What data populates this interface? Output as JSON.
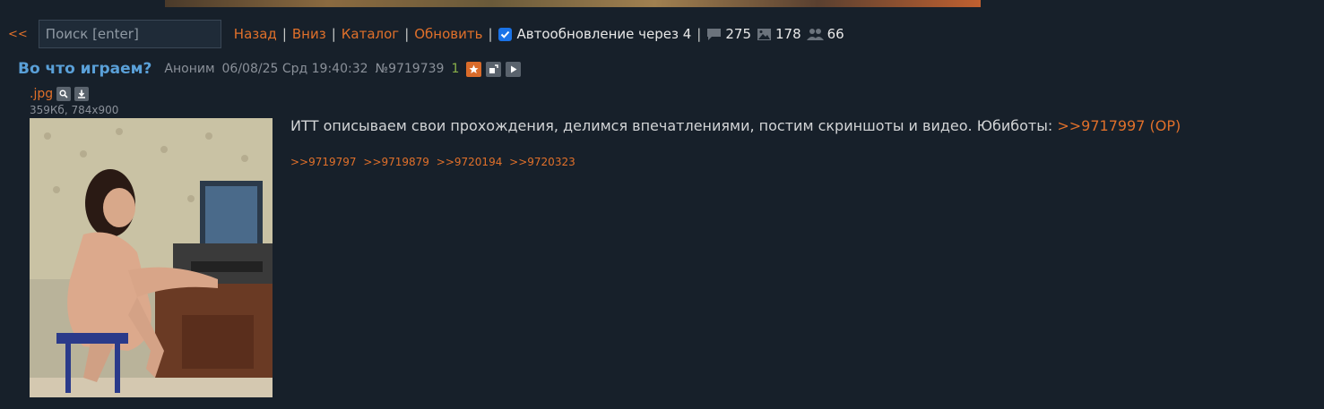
{
  "toolbar": {
    "back_label": "<<",
    "search_placeholder": "Поиск [enter]",
    "links": [
      "Назад",
      "Вниз",
      "Каталог",
      "Обновить"
    ],
    "autoupdate_label": "Автообновление через 4",
    "autoupdate_checked": true,
    "posts_count": "275",
    "images_count": "178",
    "posters_count": "66"
  },
  "post": {
    "subject": "Во что играем?",
    "author": "Аноним",
    "datetime": "06/08/25 Срд 19:40:32",
    "number": "№9719739",
    "reply_count": "1",
    "file": {
      "name": ".jpg",
      "meta": "359Кб, 784x900"
    },
    "text": "ИТТ описываем свои прохождения, делимся впечатлениями, постим скриншоты и видео. Юбиботы: ",
    "op_link": ">>9717997 (OP)",
    "reply_links": [
      ">>9719797",
      ">>9719879",
      ">>9720194",
      ">>9720323"
    ]
  },
  "colors": {
    "background": "#17202a",
    "accent": "#e0702a",
    "subject": "#5aa0d8"
  }
}
